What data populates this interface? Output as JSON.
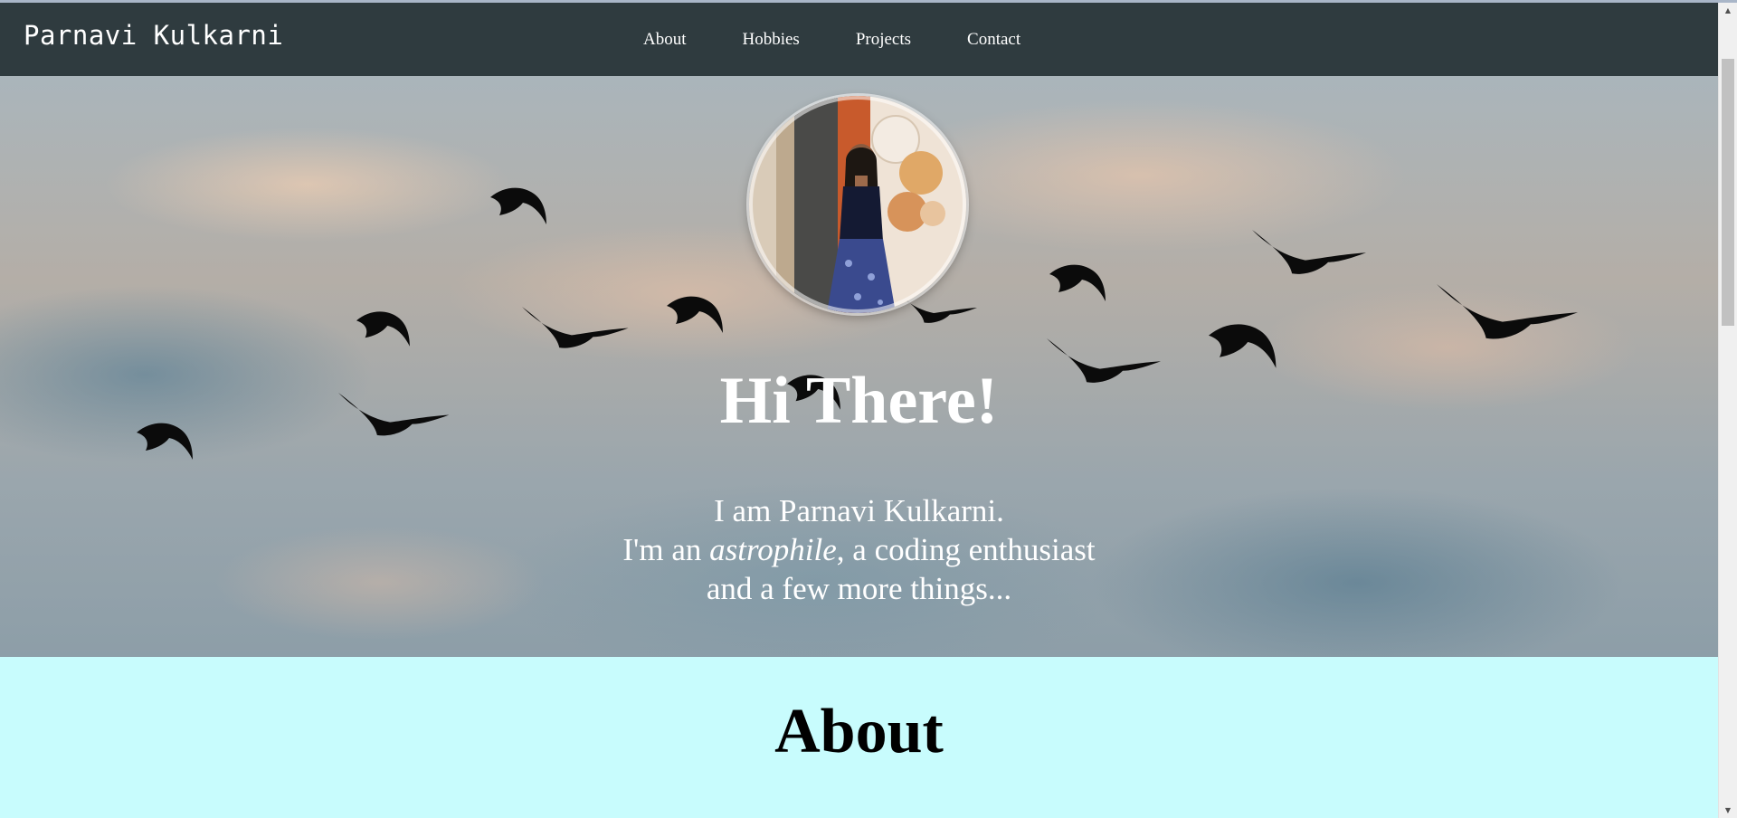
{
  "navbar": {
    "brand": "Parnavi Kulkarni",
    "links": [
      "About",
      "Hobbies",
      "Projects",
      "Contact"
    ]
  },
  "hero": {
    "title": "Hi There!",
    "line1": "I am Parnavi Kulkarni.",
    "line2_prefix": "I'm an ",
    "line2_em": "astrophile",
    "line2_suffix": ", a coding enthusiast",
    "line3": "and a few more things..."
  },
  "about": {
    "title": "About"
  },
  "icons": {
    "scroll_up": "scroll-up-arrow-icon",
    "scroll_down": "scroll-down-arrow-icon"
  },
  "colors": {
    "navbar_bg": "#2f3b3f",
    "about_bg": "#c8fcfd",
    "text_light": "#ffffff"
  }
}
